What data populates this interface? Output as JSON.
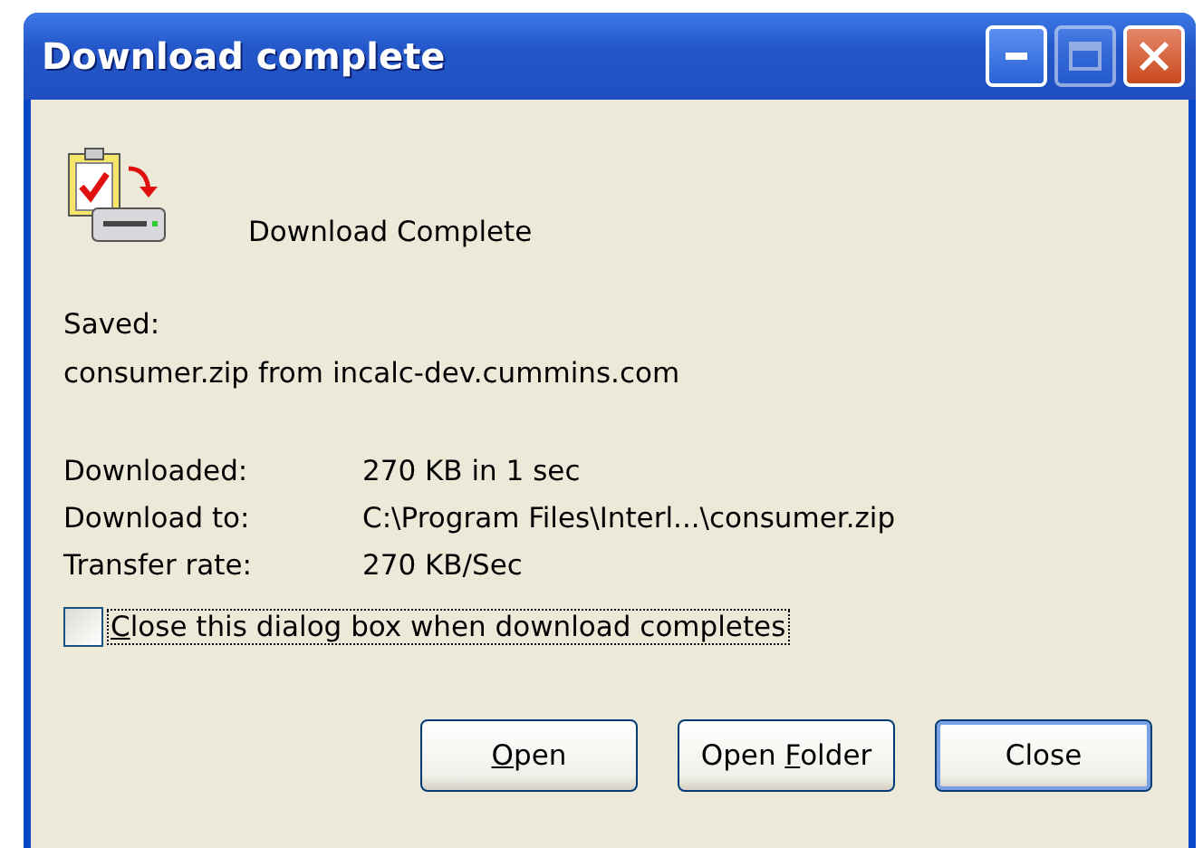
{
  "window": {
    "title": "Download complete",
    "controls": [
      {
        "kind": "minimize",
        "disabled": false
      },
      {
        "kind": "maximize",
        "disabled": true
      },
      {
        "kind": "close",
        "disabled": false
      }
    ]
  },
  "heading": "Download Complete",
  "saved_label": "Saved:",
  "saved_value": "consumer.zip from incalc-dev.cummins.com",
  "details": [
    {
      "label": "Downloaded:",
      "value": "270 KB in 1 sec"
    },
    {
      "label": "Download to:",
      "value": "C:\\Program Files\\Interl...\\consumer.zip"
    },
    {
      "label": "Transfer rate:",
      "value": "270 KB/Sec"
    }
  ],
  "close_when_done": {
    "mnemonic": "C",
    "after": "lose this dialog box when download completes",
    "checked": false,
    "focused": true
  },
  "buttons": [
    {
      "mnemonic": "O",
      "after": "pen",
      "default": false
    },
    {
      "before": "Open ",
      "mnemonic": "F",
      "after": "older",
      "default": false
    },
    {
      "before": "Close",
      "default": true
    }
  ]
}
